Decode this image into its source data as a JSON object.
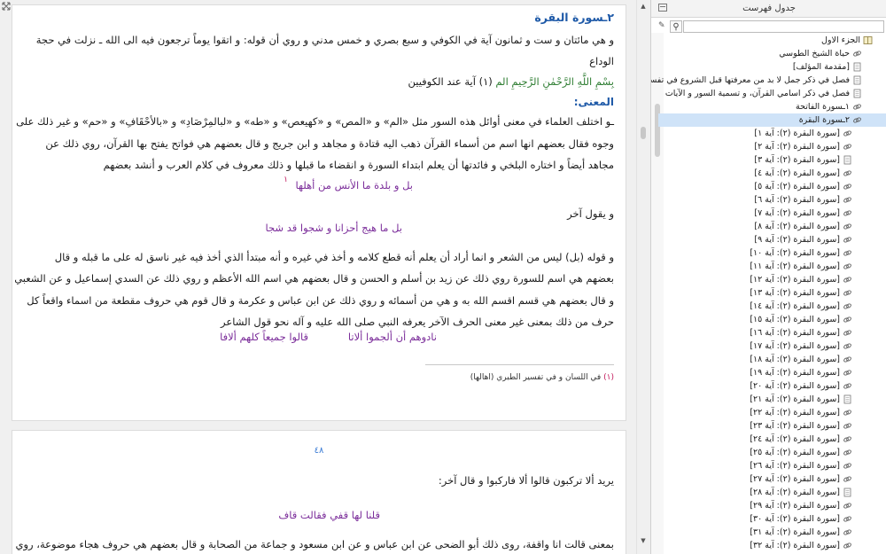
{
  "page1": {
    "sura_title": "٢ـسورة البقرة",
    "intro_lines": [
      "و هي مائتان و ست و ثمانون آية في الكوفي و سبع بصري و خمس مدني و روي أن قوله: و اتقوا يوماً ترجعون فيه الى الله ـ نزلت في حجة",
      "الوداع"
    ],
    "basmala": "بِسْمِ اللَّهِ الرَّحْمٰنِ الرَّحِيمِ الم",
    "basmala_suffix": " (١) آية عند الكوفيين",
    "meaning_heading": "المعنى:",
    "meaning_lines": [
      "ـو اختلف العلماء في معنى أوائل هذه السور مثل «الم» و «المص» و «كهيعص» و «طه» و «لبالمِرْصَادِ» و «بالأحْقَافِ» و «حم» و غير ذلك على",
      "وجوه فقال بعضهم انها اسم من أسماء القرآن ذهب اليه قتادة و مجاهد و ابن جريج و قال بعضهم هي فواتح يفتح بها القرآن، روي ذلك عن",
      "مجاهد أيضاً و اختاره البلخي و فائدتها أن يعلم ابتداء السورة و انقضاء ما قبلها و ذلك معروف في كلام العرب و أنشد بعضهم"
    ],
    "poem1": "بل و بلدة ما الأنس من أهلها",
    "poem1_marker": "١",
    "line_other": "و يقول آخر",
    "poem2": "بل ما هيج أحزانا و شجوا قد شجا",
    "body_lines": [
      "و قوله (بل) ليس من الشعر و انما أراد أن يعلم أنه قطع كلامه و أخذ في غيره و أنه مبتدأ الذي أخذ فيه غير ناسق له على ما قبله و قال",
      "بعضهم هي اسم للسورة روي ذلك عن زيد بن أسلم و الحسن و قال بعضهم هي اسم الله الأعظم و روي ذلك عن السدي إسماعيل و عن الشعبي",
      "و قال بعضهم هي قسم اقسم الله به و هي من أسمائه و روي ذلك عن ابن عباس و عكرمة و قال قوم هي حروف مقطعة من اسماء واقعاً كل",
      "حرف من ذلك بمعنى غير معنى الحرف الآخر يعرفه النبي صلى الله عليه و آله نحو قول الشاعر"
    ],
    "poem3_right": "نادوهم أن ألجموا ألاتا",
    "poem3_left": "قالوا جميعاً كلهم ألافا",
    "footnote_num": "(١)",
    "footnote_text": "في اللسان و في تفسير الطبري (اهالها)"
  },
  "page2": {
    "page_number": "٤٨",
    "line1": "يريد ألا تركبون قالوا ألا فاركبوا و قال آخر:",
    "poem": "قلنا لها قفي فقالت قاف",
    "line2": "بمعنى قالت انا واقفة، روى ذلك أبو الضحى عن ابن عباس و عن ابن مسعود و جماعة من الصحابة و قال بعضهم هي حروف هجاء موضوعة، روي"
  },
  "toc": {
    "title": "جدول فهرست",
    "search_placeholder": "",
    "items": [
      {
        "label": "الجزء الاول",
        "icon": "book-icon",
        "indent": 0
      },
      {
        "label": "حياة الشيخ الطوسي",
        "icon": "link-icon",
        "indent": 1
      },
      {
        "label": "[مقدمة المؤلف]",
        "icon": "page-icon",
        "indent": 1
      },
      {
        "label": "فصل في ذكر جمل لا بد من معرفتها قبل الشروع في تفسير القرآن",
        "icon": "page-icon",
        "indent": 1
      },
      {
        "label": "فصل في ذكر اسامي القرآن، و تسمية السور و الآيات",
        "icon": "page-icon",
        "indent": 1
      },
      {
        "label": "١ـسورة الفاتحة",
        "icon": "link-icon",
        "indent": 1
      },
      {
        "label": "٢ـسورة البقرة",
        "icon": "link-icon",
        "indent": 1,
        "selected": true
      },
      {
        "label": "[سورة البقرة (٢): آية ١]",
        "icon": "link-icon",
        "indent": 2
      },
      {
        "label": "[سورة البقرة (٢): آية ٢]",
        "icon": "link-icon",
        "indent": 2
      },
      {
        "label": "[سورة البقرة (٢): آية ٣]",
        "icon": "page-icon",
        "indent": 2
      },
      {
        "label": "[سورة البقرة (٢): آية ٤]",
        "icon": "link-icon",
        "indent": 2
      },
      {
        "label": "[سورة البقرة (٢): آية ٥]",
        "icon": "link-icon",
        "indent": 2
      },
      {
        "label": "[سورة البقرة (٢): آية ٦]",
        "icon": "link-icon",
        "indent": 2
      },
      {
        "label": "[سورة البقرة (٢): آية ٧]",
        "icon": "link-icon",
        "indent": 2
      },
      {
        "label": "[سورة البقرة (٢): آية ٨]",
        "icon": "link-icon",
        "indent": 2
      },
      {
        "label": "[سورة البقرة (٢): آية ٩]",
        "icon": "link-icon",
        "indent": 2
      },
      {
        "label": "[سورة البقرة (٢): آية ١٠]",
        "icon": "link-icon",
        "indent": 2
      },
      {
        "label": "[سورة البقرة (٢): آية ١١]",
        "icon": "link-icon",
        "indent": 2
      },
      {
        "label": "[سورة البقرة (٢): آية ١٢]",
        "icon": "link-icon",
        "indent": 2
      },
      {
        "label": "[سورة البقرة (٢): آية ١٣]",
        "icon": "link-icon",
        "indent": 2
      },
      {
        "label": "[سورة البقرة (٢): آية ١٤]",
        "icon": "link-icon",
        "indent": 2
      },
      {
        "label": "[سورة البقرة (٢): آية ١٥]",
        "icon": "link-icon",
        "indent": 2
      },
      {
        "label": "[سورة البقرة (٢): آية ١٦]",
        "icon": "link-icon",
        "indent": 2
      },
      {
        "label": "[سورة البقرة (٢): آية ١٧]",
        "icon": "link-icon",
        "indent": 2
      },
      {
        "label": "[سورة البقرة (٢): آية ١٨]",
        "icon": "link-icon",
        "indent": 2
      },
      {
        "label": "[سورة البقرة (٢): آية ١٩]",
        "icon": "link-icon",
        "indent": 2
      },
      {
        "label": "[سورة البقرة (٢): آية ٢٠]",
        "icon": "link-icon",
        "indent": 2
      },
      {
        "label": "[سورة البقرة (٢): آية ٢١]",
        "icon": "page-icon",
        "indent": 2
      },
      {
        "label": "[سورة البقرة (٢): آية ٢٢]",
        "icon": "link-icon",
        "indent": 2
      },
      {
        "label": "[سورة البقرة (٢): آية ٢٣]",
        "icon": "link-icon",
        "indent": 2
      },
      {
        "label": "[سورة البقرة (٢): آية ٢٤]",
        "icon": "link-icon",
        "indent": 2
      },
      {
        "label": "[سورة البقرة (٢): آية ٢٥]",
        "icon": "link-icon",
        "indent": 2
      },
      {
        "label": "[سورة البقرة (٢): آية ٢٦]",
        "icon": "link-icon",
        "indent": 2
      },
      {
        "label": "[سورة البقرة (٢): آية ٢٧]",
        "icon": "link-icon",
        "indent": 2
      },
      {
        "label": "[سورة البقرة (٢): آية ٢٨]",
        "icon": "page-icon",
        "indent": 2
      },
      {
        "label": "[سورة البقرة (٢): آية ٢٩]",
        "icon": "link-icon",
        "indent": 2
      },
      {
        "label": "[سورة البقرة (٢): آية ٣٠]",
        "icon": "link-icon",
        "indent": 2
      },
      {
        "label": "[سورة البقرة (٢): آية ٣١]",
        "icon": "link-icon",
        "indent": 2
      },
      {
        "label": "[سورة البقرة (٢): آية ٣٢]",
        "icon": "link-icon",
        "indent": 2
      }
    ]
  }
}
